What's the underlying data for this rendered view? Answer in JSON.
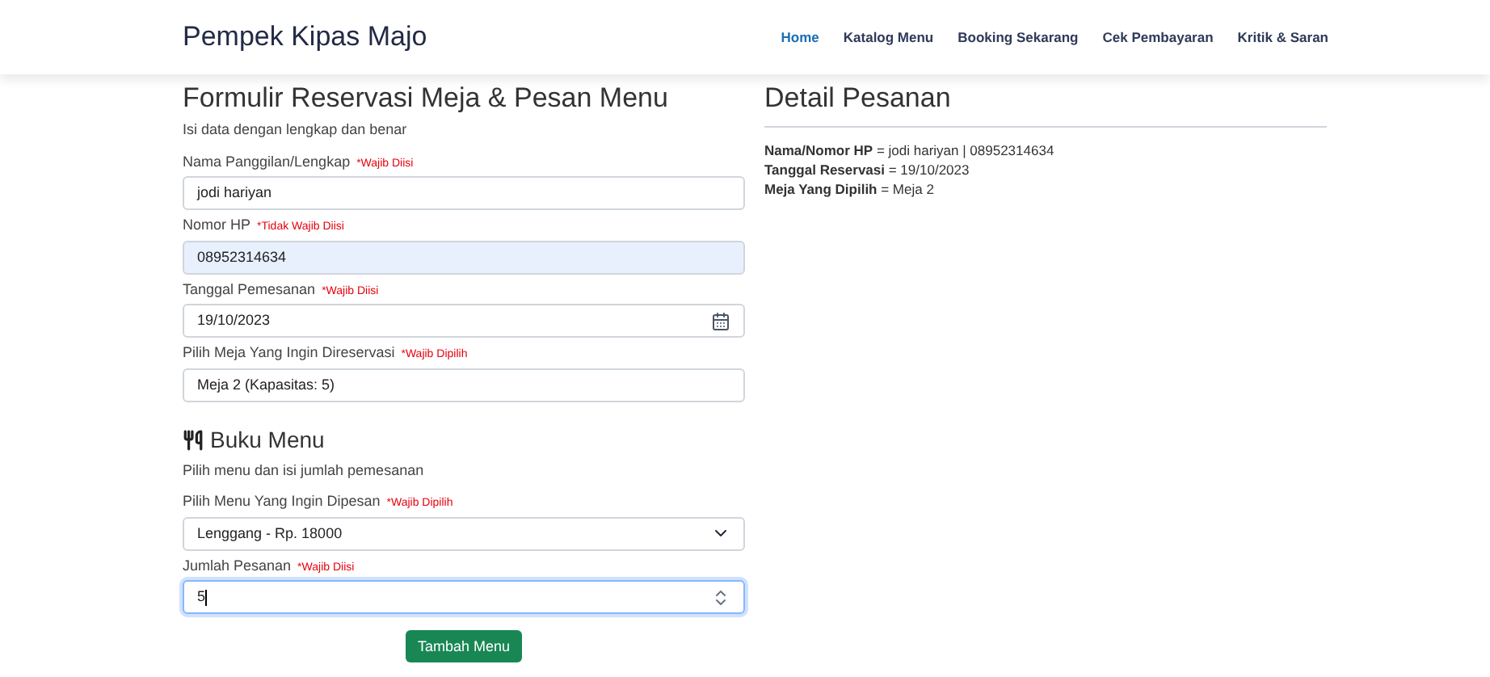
{
  "brand": "Pempek Kipas Majo",
  "nav": [
    {
      "label": "Home",
      "selected": true
    },
    {
      "label": "Katalog Menu",
      "selected": false
    },
    {
      "label": "Booking Sekarang",
      "selected": false
    },
    {
      "label": "Cek Pembayaran",
      "selected": false
    },
    {
      "label": "Kritik & Saran",
      "selected": false
    }
  ],
  "form": {
    "title": "Formulir Reservasi Meja & Pesan Menu",
    "subtitle": "Isi data dengan lengkap dan benar",
    "fields": [
      {
        "kind": "text",
        "label": "Nama Panggilan/Lengkap",
        "note": "*Wajib Diisi",
        "value": "jodi hariyan",
        "autofilled": false,
        "focused": false
      },
      {
        "kind": "text",
        "label": "Nomor HP",
        "note": "*Tidak Wajib Diisi",
        "value": "08952314634",
        "autofilled": true,
        "focused": false
      },
      {
        "kind": "date",
        "label": "Tanggal Pemesanan",
        "note": "*Wajib Diisi",
        "value": "19/10/2023",
        "autofilled": false,
        "focused": false
      },
      {
        "kind": "text",
        "label": "Pilih Meja Yang Ingin Direservasi",
        "note": "*Wajib Dipilih",
        "value": "Meja 2 (Kapasitas: 5)",
        "autofilled": false,
        "focused": false
      }
    ]
  },
  "menu": {
    "title": "Buku Menu",
    "subtitle": "Pilih menu dan isi jumlah pemesanan",
    "fields": [
      {
        "kind": "select",
        "label": "Pilih Menu Yang Ingin Dipesan",
        "note": "*Wajib Dipilih",
        "value": "Lenggang - Rp. 18000",
        "autofilled": false,
        "focused": false
      },
      {
        "kind": "number",
        "label": "Jumlah Pesanan",
        "note": "*Wajib Diisi",
        "value": "5",
        "autofilled": false,
        "focused": true
      }
    ],
    "button": "Tambah Menu"
  },
  "detail": {
    "title": "Detail Pesanan",
    "lines": [
      "**Nama/Nomor HP** = jodi hariyan | 08952314634",
      "**Tanggal Reservasi** = 19/10/2023",
      "**Meja Yang Dipilih** = Meja 2"
    ]
  }
}
